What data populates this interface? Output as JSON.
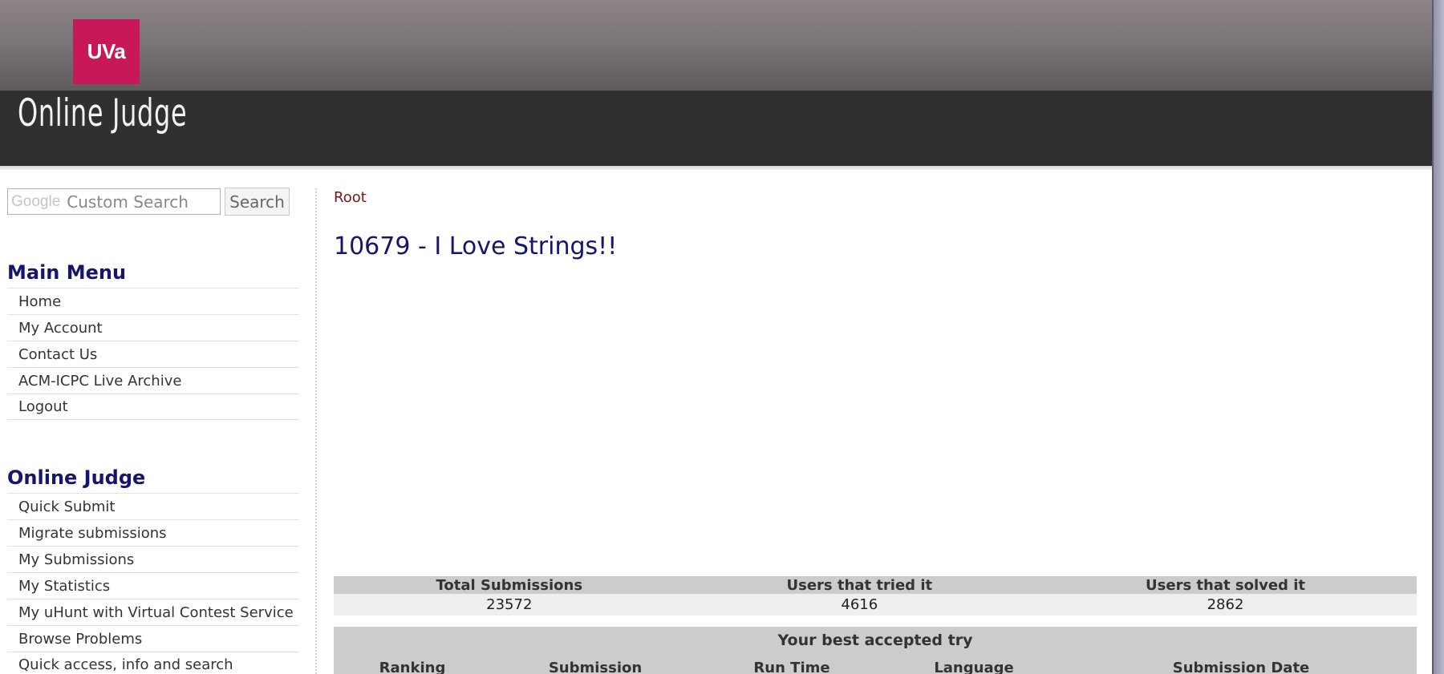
{
  "header": {
    "logo_text": "UVa",
    "site_title": "Online Judge"
  },
  "search": {
    "placeholder": "Custom Search",
    "google_label": "Google",
    "button_label": "Search"
  },
  "main_menu": {
    "heading": "Main Menu",
    "items": [
      "Home",
      "My Account",
      "Contact Us",
      "ACM-ICPC Live Archive",
      "Logout"
    ]
  },
  "judge_menu": {
    "heading": "Online Judge",
    "items": [
      "Quick Submit",
      "Migrate submissions",
      "My Submissions",
      "My Statistics",
      "My uHunt with Virtual Contest Service",
      "Browse Problems",
      "Quick access, info and search"
    ]
  },
  "breadcrumb": "Root",
  "problem": {
    "title": "10679 - I Love Strings!!"
  },
  "stats": {
    "headers": [
      "Total Submissions",
      "Users that tried it",
      "Users that solved it"
    ],
    "values": [
      "23572",
      "4616",
      "2862"
    ]
  },
  "best_try": {
    "title": "Your best accepted try",
    "columns": [
      "Ranking",
      "Submission",
      "Run Time",
      "Language",
      "Submission Date"
    ]
  }
}
